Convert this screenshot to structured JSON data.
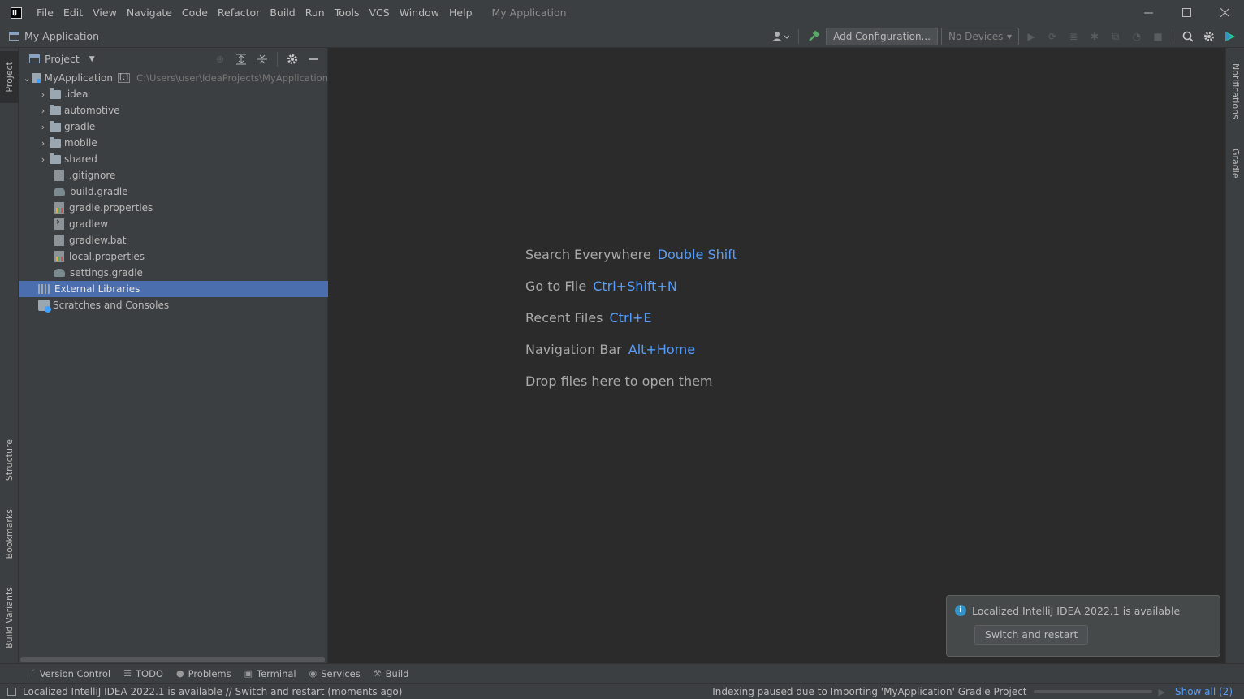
{
  "app": {
    "logo": "IJ",
    "window_title": "My Application"
  },
  "menu": [
    "File",
    "Edit",
    "View",
    "Navigate",
    "Code",
    "Refactor",
    "Build",
    "Run",
    "Tools",
    "VCS",
    "Window",
    "Help"
  ],
  "navbar": {
    "title": "My Application",
    "add_config_label": "Add Configuration...",
    "devices_label": "No Devices"
  },
  "left_strip": {
    "project": "Project",
    "structure": "Structure",
    "bookmarks": "Bookmarks",
    "build_variants": "Build Variants"
  },
  "right_strip": {
    "notifications": "Notifications",
    "gradle": "Gradle"
  },
  "project_panel": {
    "title": "Project",
    "tree": [
      {
        "label": "MyApplication",
        "badge": "[:]",
        "path": "C:\\Users\\user\\IdeaProjects\\MyApplication"
      },
      {
        "label": ".idea"
      },
      {
        "label": "automotive"
      },
      {
        "label": "gradle"
      },
      {
        "label": "mobile"
      },
      {
        "label": "shared"
      },
      {
        "label": ".gitignore"
      },
      {
        "label": "build.gradle"
      },
      {
        "label": "gradle.properties"
      },
      {
        "label": "gradlew"
      },
      {
        "label": "gradlew.bat"
      },
      {
        "label": "local.properties"
      },
      {
        "label": "settings.gradle"
      },
      {
        "label": "External Libraries"
      },
      {
        "label": "Scratches and Consoles"
      }
    ]
  },
  "editor": {
    "hints": [
      {
        "text": "Search Everywhere",
        "key": "Double Shift"
      },
      {
        "text": "Go to File",
        "key": "Ctrl+Shift+N"
      },
      {
        "text": "Recent Files",
        "key": "Ctrl+E"
      },
      {
        "text": "Navigation Bar",
        "key": "Alt+Home"
      },
      {
        "text": "Drop files here to open them",
        "key": ""
      }
    ]
  },
  "notification": {
    "message": "Localized IntelliJ IDEA 2022.1 is available",
    "button": "Switch and restart"
  },
  "bottom_tabs": [
    "Version Control",
    "TODO",
    "Problems",
    "Terminal",
    "Services",
    "Build"
  ],
  "status": {
    "message": "Localized IntelliJ IDEA 2022.1 is available // Switch and restart (moments ago)",
    "indexing": "Indexing paused due to Importing 'MyApplication' Gradle Project",
    "show_all": "Show all (2)"
  }
}
